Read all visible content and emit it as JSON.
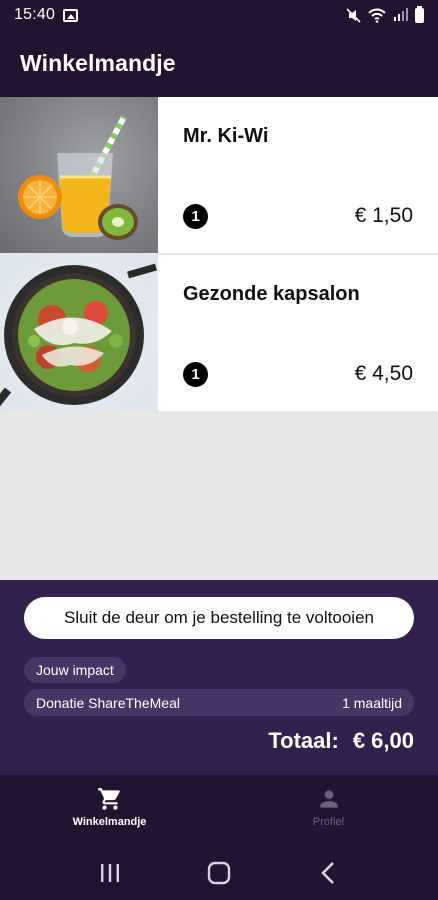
{
  "status_bar": {
    "time": "15:40",
    "icons": [
      "gallery-icon",
      "mute-icon",
      "wifi-icon",
      "signal-icon",
      "battery-icon"
    ]
  },
  "app_bar": {
    "title": "Winkelmandje"
  },
  "cart": {
    "items": [
      {
        "name": "Mr. Ki-Wi",
        "quantity": "1",
        "price": "€ 1,50",
        "image": "juice-photo"
      },
      {
        "name": "Gezonde kapsalon",
        "quantity": "1",
        "price": "€ 4,50",
        "image": "salad-pan-photo"
      }
    ]
  },
  "checkout": {
    "cta_label": "Sluit de deur om je bestelling te voltooien",
    "impact_label": "Jouw impact",
    "donation_label": "Donatie ShareTheMeal",
    "donation_value": "1 maaltijd",
    "total_label": "Totaal:",
    "total_value": "€ 6,00"
  },
  "bottom_nav": {
    "items": [
      {
        "label": "Winkelmandje",
        "icon": "cart-icon",
        "active": true
      },
      {
        "label": "Profiel",
        "icon": "person-icon",
        "active": false
      }
    ]
  },
  "system_nav": {
    "icons": [
      "recent-apps-icon",
      "home-icon",
      "back-icon"
    ]
  },
  "colors": {
    "header_bg": "#22132f",
    "panel_bg": "#32214d",
    "chip_bg": "#473566",
    "list_bg": "#e8e8e8"
  }
}
